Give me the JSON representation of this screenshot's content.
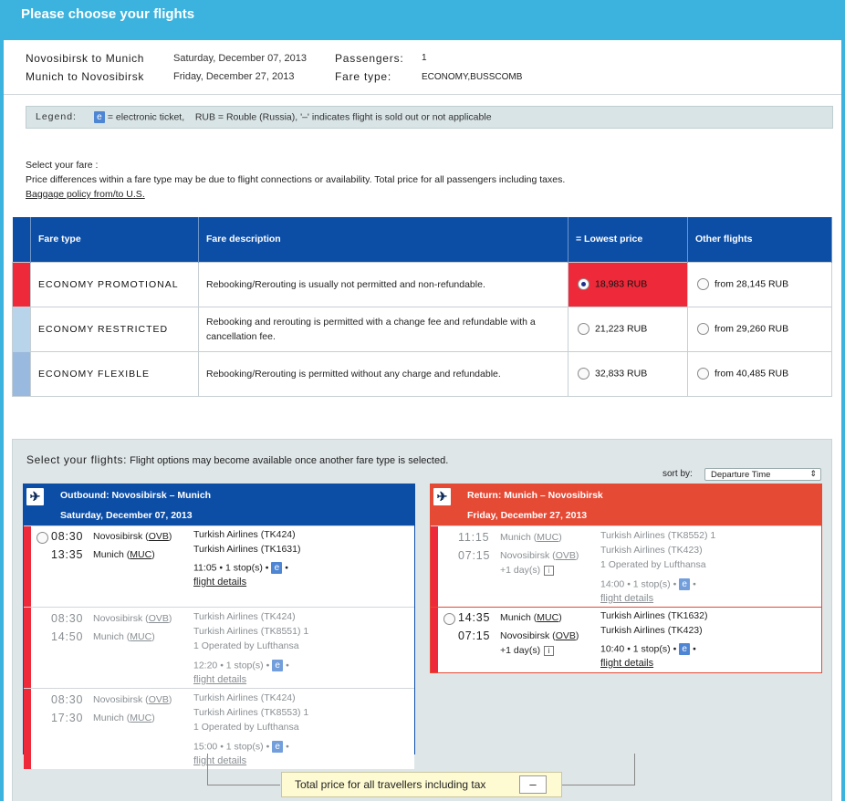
{
  "page": {
    "title": "Please choose your flights"
  },
  "trip": {
    "outbound_route": "Novosibirsk to Munich",
    "outbound_date": "Saturday, December 07, 2013",
    "return_route": "Munich to Novosibirsk",
    "return_date": "Friday, December 27, 2013",
    "passengers_label": "Passengers:",
    "passengers_value": "1",
    "fare_type_label": "Fare type:",
    "fare_type_value": "ECONOMY,BUSSCOMB"
  },
  "legend": {
    "label": "Legend:",
    "e_glyph": "e",
    "e_text": "= electronic ticket,",
    "rub_code": "RUB",
    "rub_text": "= Rouble (Russia), '–' indicates flight is sold out or not applicable"
  },
  "intro": {
    "line1": "Select your fare :",
    "line2": "Price differences within a fare type may be due to flight connections or availability. Total price for all passengers including taxes.",
    "baggage_link": "Baggage policy from/to U.S."
  },
  "fares": {
    "headers": {
      "type": "Fare type",
      "desc": "Fare description",
      "lowest": "= Lowest price",
      "other": "Other flights"
    },
    "rows": [
      {
        "type": "ECONOMY PROMOTIONAL",
        "desc": "Rebooking/Rerouting is usually not permitted and non-refundable.",
        "lowest": "18,983 RUB",
        "other": "from 28,145 RUB",
        "color": "#ee2a3a"
      },
      {
        "type": "ECONOMY RESTRICTED",
        "desc": "Rebooking and rerouting is permitted with a change fee and refundable with a cancellation fee.",
        "lowest": "21,223 RUB",
        "other": "from 29,260 RUB",
        "color": "#b7d4ea"
      },
      {
        "type": "ECONOMY FLEXIBLE",
        "desc": "Rebooking/Rerouting is permitted without any charge and refundable.",
        "lowest": "32,833 RUB",
        "other": "from 40,485 RUB",
        "color": "#9ab9df"
      }
    ]
  },
  "flights": {
    "select_label": "Select your flights:",
    "select_note": "Flight options may become available once another fare type is selected.",
    "sort_label": "sort by:",
    "sort_value": "Departure Time",
    "outbound": {
      "title": "Outbound: Novosibirsk – Munich",
      "date": "Saturday, December 07, 2013",
      "color": "#0c4ea6",
      "options": [
        {
          "dep_time": "08:30",
          "dep_city": "Novosibirsk",
          "dep_code": "OVB",
          "arr_time": "13:35",
          "arr_city": "Munich",
          "arr_code": "MUC",
          "airline1": "Turkish Airlines (TK424)",
          "airline2": "Turkish Airlines (TK1631)",
          "operated": "",
          "duration": "11:05",
          "stops": "1 stop(s)",
          "details": "flight details"
        },
        {
          "dep_time": "08:30",
          "dep_city": "Novosibirsk",
          "dep_code": "OVB",
          "arr_time": "14:50",
          "arr_city": "Munich",
          "arr_code": "MUC",
          "airline1": "Turkish Airlines (TK424)",
          "airline2": "Turkish Airlines (TK8551) 1",
          "operated": "1 Operated by Lufthansa",
          "duration": "12:20",
          "stops": "1 stop(s)",
          "details": "flight details"
        },
        {
          "dep_time": "08:30",
          "dep_city": "Novosibirsk",
          "dep_code": "OVB",
          "arr_time": "17:30",
          "arr_city": "Munich",
          "arr_code": "MUC",
          "airline1": "Turkish Airlines (TK424)",
          "airline2": "Turkish Airlines (TK8553) 1",
          "operated": "1 Operated by Lufthansa",
          "duration": "15:00",
          "stops": "1 stop(s)",
          "details": "flight details"
        }
      ]
    },
    "return": {
      "title": "Return: Munich – Novosibirsk",
      "date": "Friday, December 27, 2013",
      "color": "#e54a35",
      "options": [
        {
          "dep_time": "11:15",
          "dep_city": "Munich",
          "dep_code": "MUC",
          "arr_time": "07:15",
          "arr_city": "Novosibirsk",
          "arr_code": "OVB",
          "plus": "+1 day(s)",
          "airline1": "Turkish Airlines (TK8552) 1",
          "airline2": "Turkish Airlines (TK423)",
          "operated": "1 Operated by Lufthansa",
          "duration": "14:00",
          "stops": "1 stop(s)",
          "details": "flight details"
        },
        {
          "dep_time": "14:35",
          "dep_city": "Munich",
          "dep_code": "MUC",
          "arr_time": "07:15",
          "arr_city": "Novosibirsk",
          "arr_code": "OVB",
          "plus": "+1 day(s)",
          "airline1": "Turkish Airlines (TK1632)",
          "airline2": "Turkish Airlines (TK423)",
          "operated": "",
          "duration": "10:40",
          "stops": "1 stop(s)",
          "details": "flight details"
        }
      ]
    }
  },
  "total": {
    "label": "Total price for all travellers including tax",
    "value": "–"
  },
  "icons": {
    "plane": "airplane-icon",
    "info": "info-icon",
    "electronic": "e-ticket-icon"
  }
}
